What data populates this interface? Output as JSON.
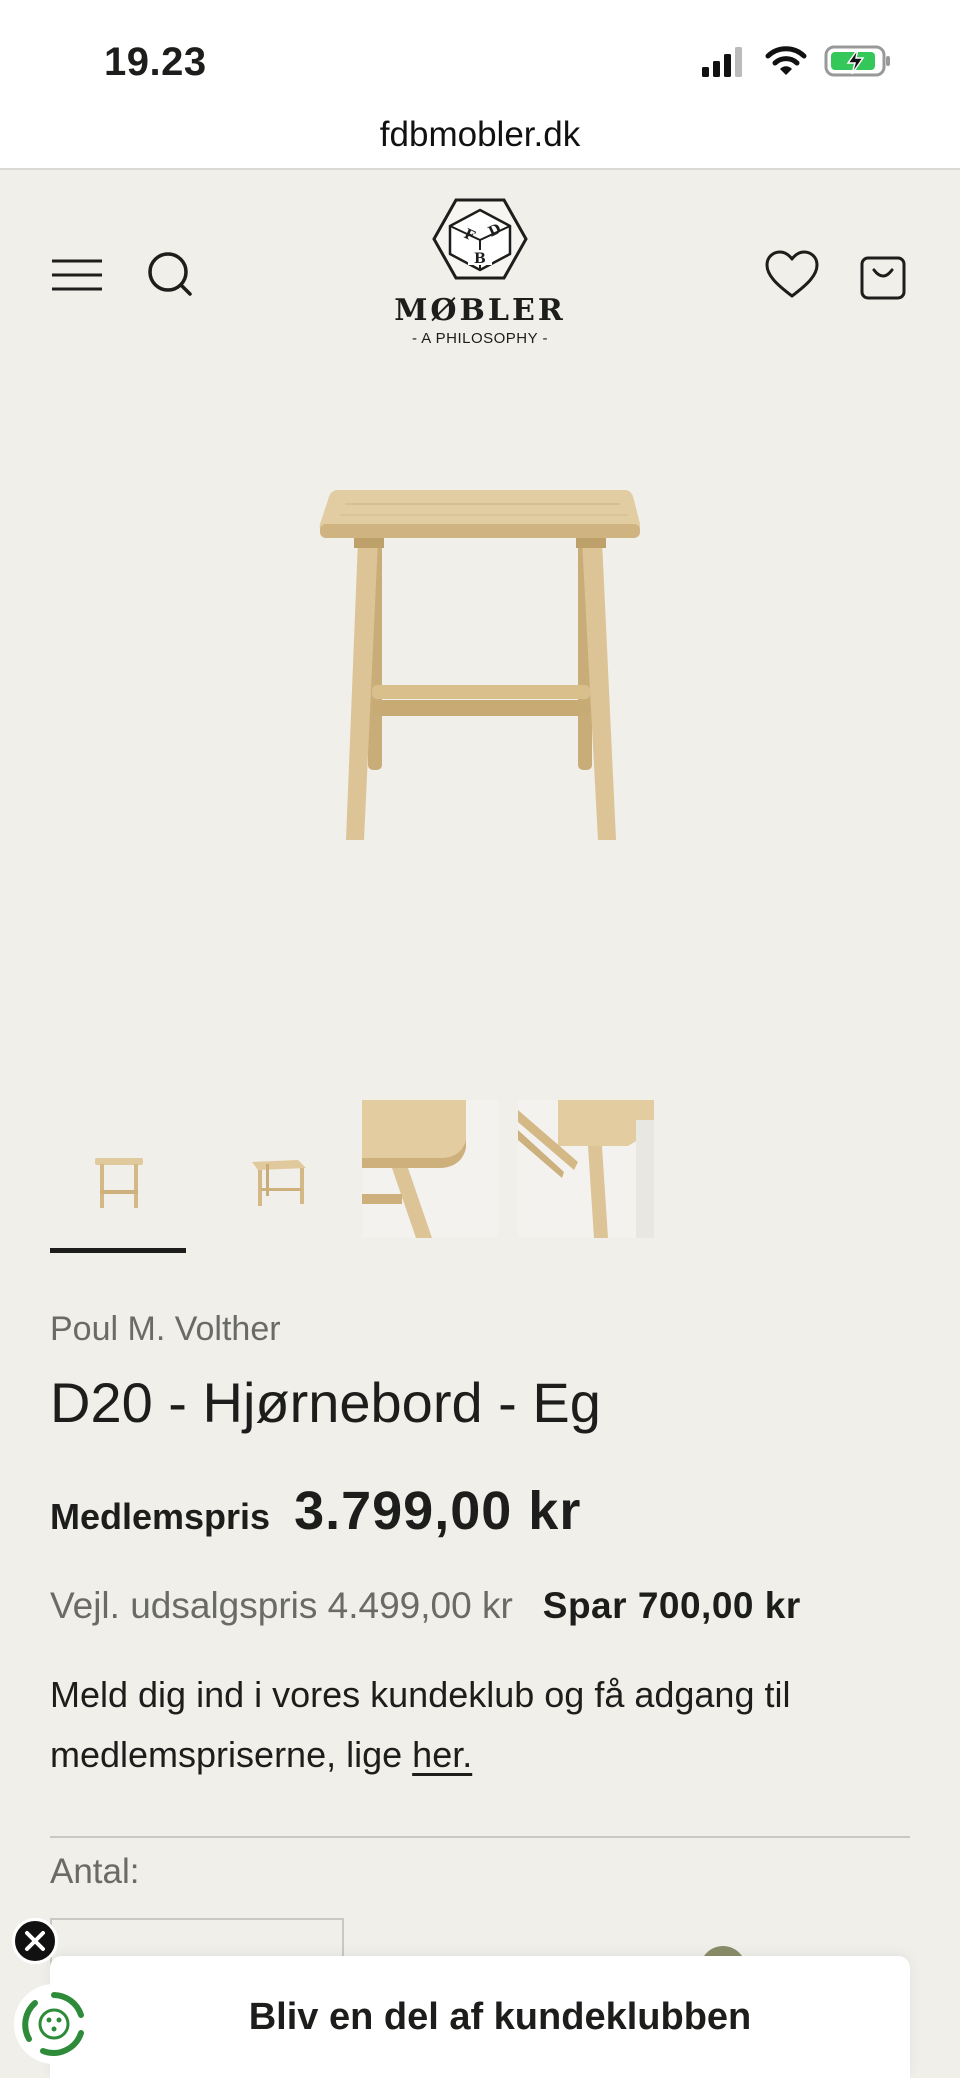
{
  "status_bar": {
    "time": "19.23"
  },
  "browser": {
    "url": "fdbmobler.dk"
  },
  "header": {
    "logo_word": "MØBLER",
    "logo_tagline": "- A PHILOSOPHY -",
    "logo_letters": "FDB"
  },
  "product": {
    "designer": "Poul M. Volther",
    "title": "D20 - Hjørnebord - Eg",
    "member_label": "Medlemspris",
    "member_price": "3.799,00 kr",
    "recommended_price": "Vejl. udsalgspris 4.499,00 kr",
    "savings": "Spar 700,00 kr",
    "club_text": "Meld dig ind i vores kundeklub og få adgang til medlemspriserne, lige",
    "club_link": "her.",
    "quantity_label": "Antal:"
  },
  "thumbnails": [
    {
      "name": "front-view"
    },
    {
      "name": "angle-view"
    },
    {
      "name": "corner-detail"
    },
    {
      "name": "leg-detail"
    }
  ],
  "club_banner": {
    "text": "Bliv en del af kundeklubben"
  },
  "colors": {
    "background": "#f0efea",
    "wood": "#d9c08c",
    "text": "#1d1d1b",
    "muted": "#6a6a66"
  }
}
